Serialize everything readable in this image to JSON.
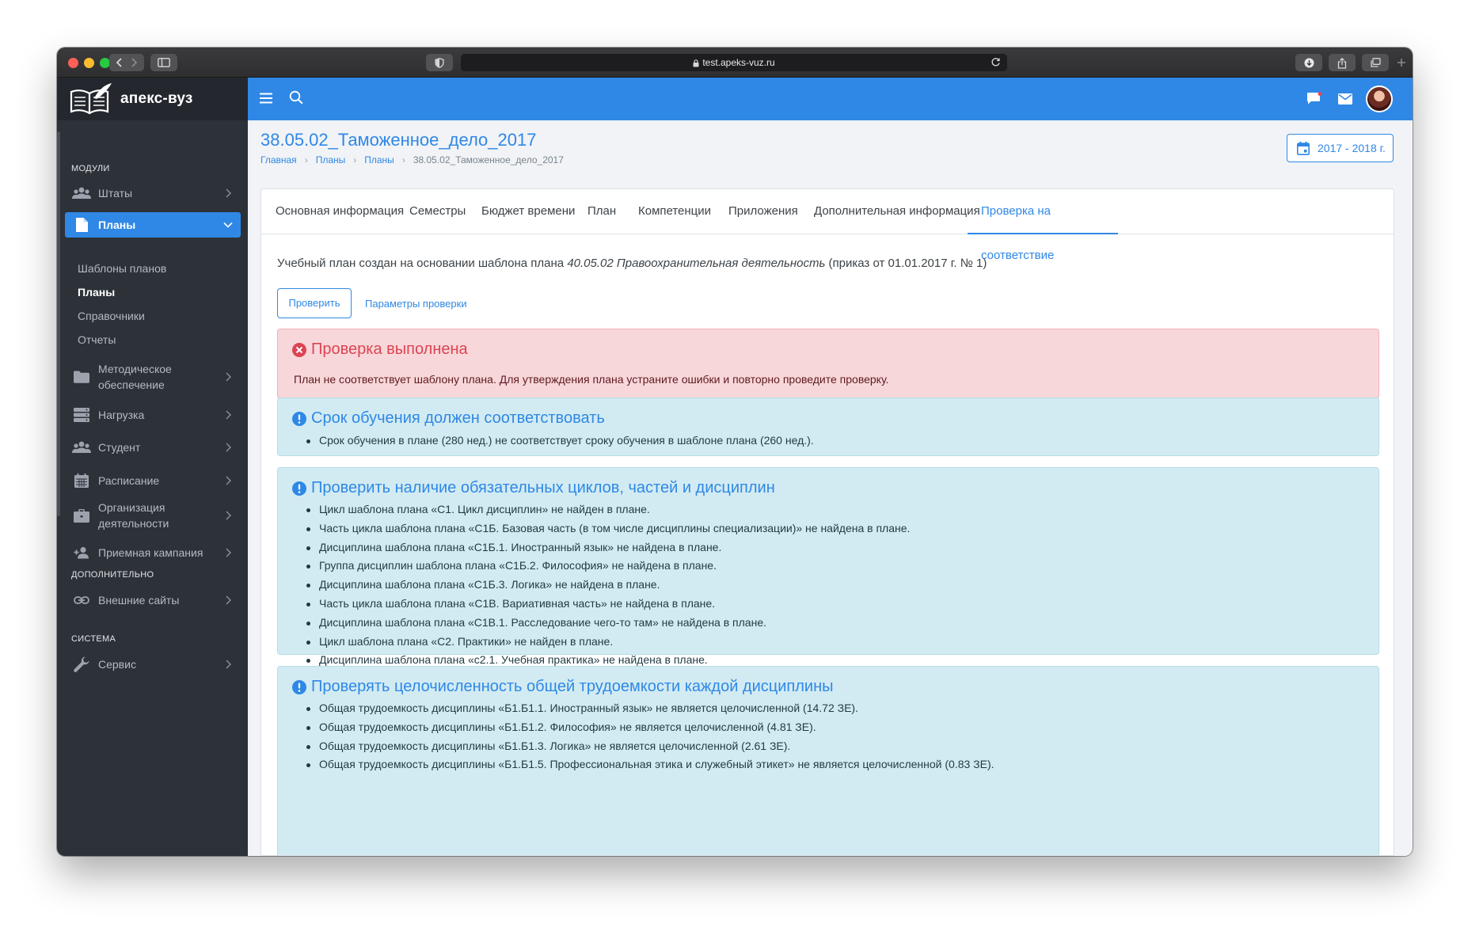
{
  "browser": {
    "url": "test.apeks-vuz.ru"
  },
  "brand": {
    "name": "апекс-вуз"
  },
  "sidebar": {
    "section_modules": "МОДУЛИ",
    "section_extra": "ДОПОЛНИТЕЛЬНО",
    "section_system": "СИСТЕМА",
    "staff": "Штаты",
    "plans": "Планы",
    "sub": [
      "Шаблоны планов",
      "Планы",
      "Справочники",
      "Отчеты"
    ],
    "method_1": "Методическое",
    "method_2": "обеспечение",
    "load": "Нагрузка",
    "student": "Студент",
    "schedule": "Расписание",
    "org_1": "Организация",
    "org_2": "деятельности",
    "admission": "Приемная кампания",
    "external": "Внешние сайты",
    "service": "Сервис"
  },
  "page": {
    "title": "38.05.02_Таможенное_дело_2017",
    "breadcrumb": [
      "Главная",
      "Планы",
      "Планы",
      "38.05.02_Таможенное_дело_2017"
    ],
    "year": "2017 - 2018 г."
  },
  "tabs": [
    "Основная информация",
    "Семестры",
    "Бюджет времени",
    "План",
    "Компетенции",
    "Приложения",
    "Дополнительная информация",
    "Проверка на соответствие"
  ],
  "intro": {
    "prefix": "Учебный план создан на основании шаблона плана",
    "template": "40.05.02 Правоохранительная деятельность",
    "suffix": "(приказ от 01.01.2017 г. № 1)"
  },
  "actions": {
    "check": "Проверить",
    "params": "Параметры проверки"
  },
  "result": {
    "title": "Проверка выполнена",
    "message": "План не соответствует шаблону плана. Для утверждения плана устраните ошибки и повторно проведите проверку."
  },
  "checks": [
    {
      "title": "Срок обучения должен соответствовать",
      "items": [
        "Срок обучения в плане (280 нед.) не соответствует сроку обучения в шаблоне плана (260 нед.)."
      ]
    },
    {
      "title": "Проверить наличие обязательных циклов, частей и дисциплин",
      "items": [
        "Цикл шаблона плана «С1. Цикл дисциплин» не найден в плане.",
        "Часть цикла шаблона плана «С1Б. Базовая часть (в том числе дисциплины специализации)» не найдена в плане.",
        "Дисциплина шаблона плана «С1Б.1. Иностранный язык» не найдена в плане.",
        "Группа дисциплин шаблона плана «С1Б.2. Философия» не найдена в плане.",
        "Дисциплина шаблона плана «С1Б.3. Логика» не найдена в плане.",
        "Часть цикла шаблона плана «С1В. Вариативная часть» не найдена в плане.",
        "Дисциплина шаблона плана «С1В.1. Расследование чего-то там» не найдена в плане.",
        "Цикл шаблона плана «С2. Практики» не найден в плане.",
        "Дисциплина шаблона плана «с2.1. Учебная практика» не найдена в плане."
      ]
    },
    {
      "title": "Проверять целочисленность общей трудоемкости каждой дисциплины",
      "items": [
        "Общая трудоемкость дисциплины «Б1.Б1.1. Иностранный язык» не является целочисленной (14.72 ЗЕ).",
        "Общая трудоемкость дисциплины «Б1.Б1.2. Философия» не является целочисленной (4.81 ЗЕ).",
        "Общая трудоемкость дисциплины «Б1.Б1.3. Логика» не является целочисленной (2.61 ЗЕ).",
        "Общая трудоемкость дисциплины «Б1.Б1.5. Профессиональная этика и служебный этикет» не является целочисленной (0.83 ЗЕ)."
      ]
    }
  ]
}
